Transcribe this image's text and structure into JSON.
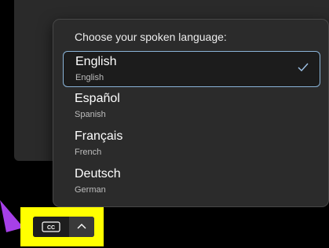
{
  "language_menu": {
    "prompt": "Choose your spoken language:",
    "options": [
      {
        "native": "English",
        "english": "English",
        "selected": true
      },
      {
        "native": "Español",
        "english": "Spanish",
        "selected": false
      },
      {
        "native": "Français",
        "english": "French",
        "selected": false
      },
      {
        "native": "Deutsch",
        "english": "German",
        "selected": false
      }
    ]
  },
  "caption_controls": {
    "cc_label": "CC",
    "icons": [
      "captions-icon",
      "chevron-up-icon"
    ]
  },
  "colors": {
    "highlight": "#ffff00",
    "pointer_arrow": "#a640e8",
    "selected_border": "#8ab4d8",
    "panel_bg": "#2b2b2b"
  }
}
